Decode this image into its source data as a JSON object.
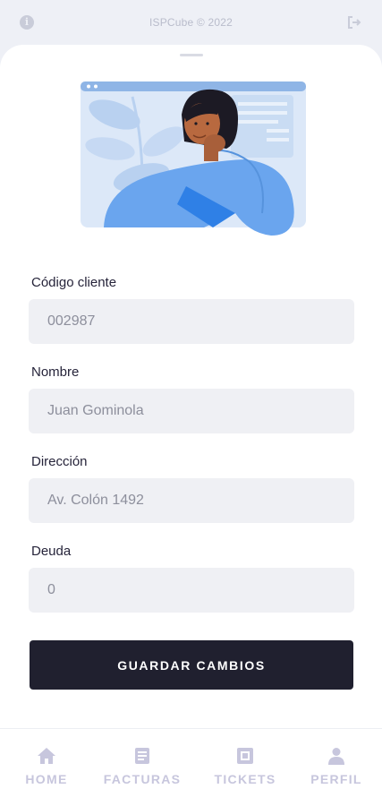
{
  "header": {
    "title": "ISPCube © 2022"
  },
  "form": {
    "fields": [
      {
        "label": "Código cliente",
        "value": "002987"
      },
      {
        "label": "Nombre",
        "value": "Juan Gominola"
      },
      {
        "label": "Dirección",
        "value": "Av. Colón 1492"
      },
      {
        "label": "Deuda",
        "value": "0"
      }
    ],
    "save_label": "GUARDAR CAMBIOS"
  },
  "nav": {
    "items": [
      {
        "label": "HOME",
        "icon": "home-icon"
      },
      {
        "label": "FACTURAS",
        "icon": "document-icon"
      },
      {
        "label": "TICKETS",
        "icon": "ticket-icon"
      },
      {
        "label": "PERFIL",
        "icon": "user-icon"
      }
    ]
  },
  "colors": {
    "background": "#eef0f6",
    "primary_button": "#20202f",
    "nav_label": "#c7c6dd",
    "input_bg": "#eff0f4",
    "illustration_blue": "#6aa5ee"
  }
}
